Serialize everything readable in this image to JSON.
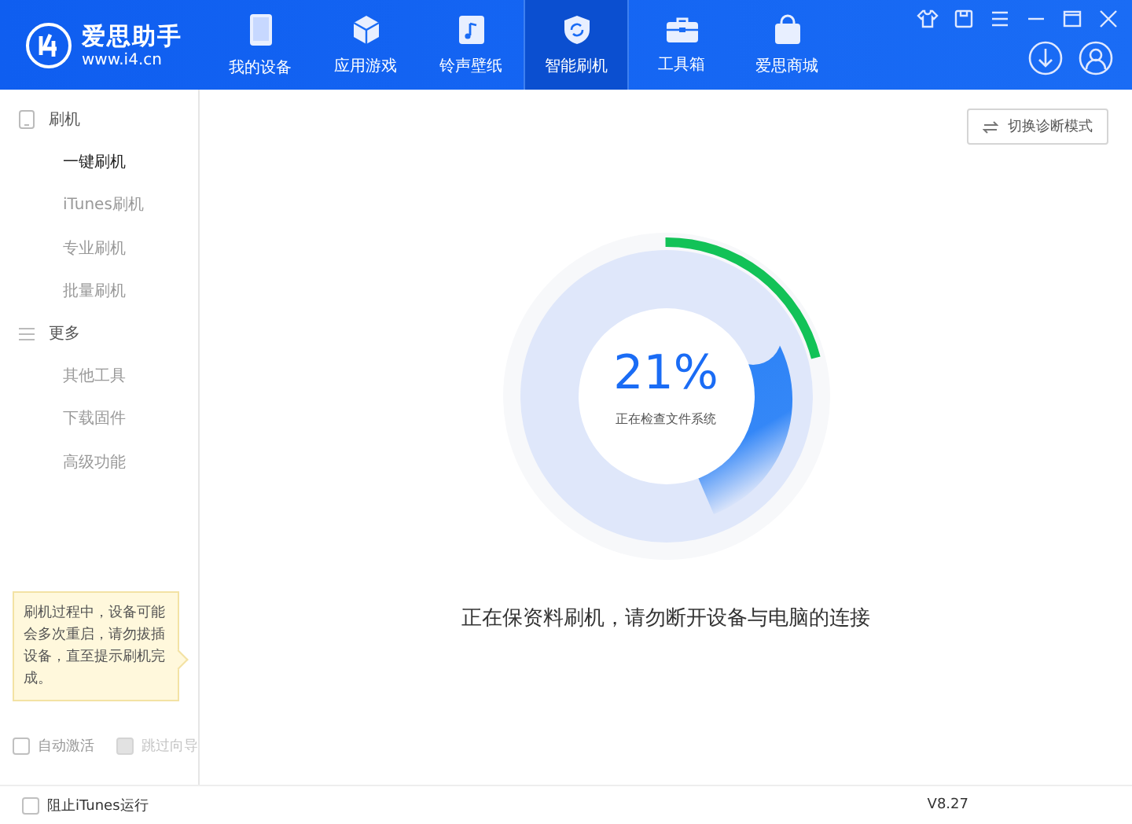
{
  "app": {
    "name": "爱思助手",
    "url": "www.i4.cn"
  },
  "nav": [
    {
      "label": "我的设备",
      "selected": false
    },
    {
      "label": "应用游戏",
      "selected": false
    },
    {
      "label": "铃声壁纸",
      "selected": false
    },
    {
      "label": "智能刷机",
      "selected": true
    },
    {
      "label": "工具箱",
      "selected": false
    },
    {
      "label": "爱思商城",
      "selected": false
    }
  ],
  "sidebar": {
    "groups": [
      {
        "label": "刷机",
        "kind": "device",
        "children": [
          {
            "label": "一键刷机",
            "selected": true
          },
          {
            "label": "iTunes刷机",
            "selected": false
          },
          {
            "label": "专业刷机",
            "selected": false
          },
          {
            "label": "批量刷机",
            "selected": false
          }
        ]
      },
      {
        "label": "更多",
        "kind": "list",
        "children": [
          {
            "label": "其他工具",
            "selected": false
          },
          {
            "label": "下载固件",
            "selected": false
          },
          {
            "label": "高级功能",
            "selected": false
          }
        ]
      }
    ],
    "tip": "刷机过程中，设备可能会多次重启，请勿拔插设备，直至提示刷机完成。",
    "options": [
      {
        "label": "自动激活",
        "checked": false,
        "disabled": false
      },
      {
        "label": "跳过向导",
        "checked": false,
        "disabled": true
      }
    ]
  },
  "mode_button": "切换诊断模式",
  "progress": {
    "level": 0.21,
    "percent": "21%",
    "stage": "正在检查文件系统"
  },
  "message": "正在保资料刷机，请勿断开设备与电脑的连接",
  "status_bar": {
    "block_itunes": {
      "label": "阻止iTunes运行",
      "checked": false
    },
    "version": "V8.27"
  }
}
